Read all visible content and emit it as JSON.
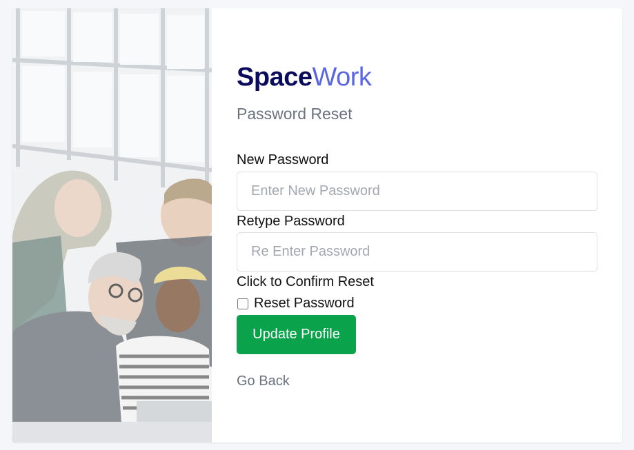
{
  "brand": {
    "part1": "Space",
    "part2": "Work"
  },
  "page": {
    "subtitle": "Password Reset"
  },
  "form": {
    "new_password": {
      "label": "New Password",
      "placeholder": "Enter New Password",
      "value": ""
    },
    "retype_password": {
      "label": "Retype Password",
      "placeholder": "Re Enter Password",
      "value": ""
    },
    "confirm_text": "Click to Confirm Reset",
    "reset_checkbox": {
      "label": "Reset Password",
      "checked": false
    },
    "submit_label": "Update Profile",
    "back_link": "Go Back"
  },
  "colors": {
    "brand_dark": "#0b0b5c",
    "brand_accent": "#5a67e0",
    "button": "#0aa34c",
    "muted_text": "#6b7280",
    "background": "#f4f6f9"
  },
  "image": {
    "alt": "hero-photo-team-at-laptop"
  }
}
